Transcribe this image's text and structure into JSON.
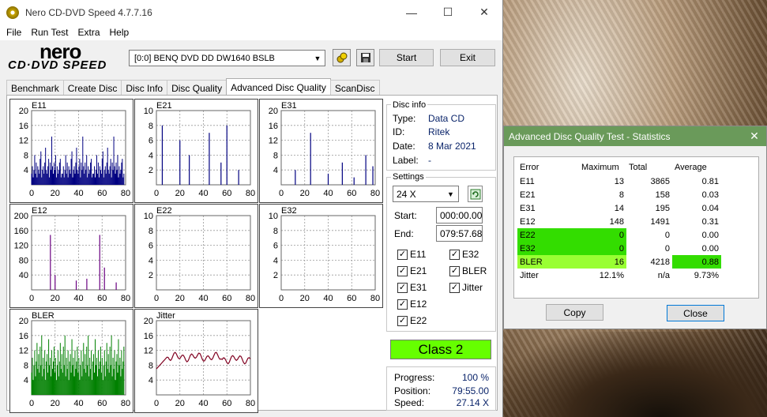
{
  "window": {
    "title": "Nero CD-DVD Speed 4.7.7.16"
  },
  "menu": [
    "File",
    "Run Test",
    "Extra",
    "Help"
  ],
  "logo": {
    "brand": "nero",
    "sub": "CD·DVD SPEED"
  },
  "drive": {
    "selected": "[0:0]   BENQ DVD DD DW1640 BSLB"
  },
  "buttons": {
    "start": "Start",
    "exit": "Exit"
  },
  "tabs": [
    "Benchmark",
    "Create Disc",
    "Disc Info",
    "Disc Quality",
    "Advanced Disc Quality",
    "ScanDisc"
  ],
  "charts": {
    "e11": {
      "label": "E11",
      "yticks": [
        "20",
        "16",
        "12",
        "8",
        "4"
      ],
      "xticks": [
        "0",
        "20",
        "40",
        "60",
        "80"
      ]
    },
    "e21": {
      "label": "E21",
      "yticks": [
        "10",
        "8",
        "6",
        "4",
        "2"
      ],
      "xticks": [
        "0",
        "20",
        "40",
        "60",
        "80"
      ]
    },
    "e31": {
      "label": "E31",
      "yticks": [
        "20",
        "16",
        "12",
        "8",
        "4"
      ],
      "xticks": [
        "0",
        "20",
        "40",
        "60",
        "80"
      ]
    },
    "e12": {
      "label": "E12",
      "yticks": [
        "200",
        "160",
        "120",
        "80",
        "40"
      ],
      "xticks": [
        "0",
        "20",
        "40",
        "60",
        "80"
      ]
    },
    "e22": {
      "label": "E22",
      "yticks": [
        "10",
        "8",
        "6",
        "4",
        "2"
      ],
      "xticks": [
        "0",
        "20",
        "40",
        "60",
        "80"
      ]
    },
    "e32": {
      "label": "E32",
      "yticks": [
        "10",
        "8",
        "6",
        "4",
        "2"
      ],
      "xticks": [
        "0",
        "20",
        "40",
        "60",
        "80"
      ]
    },
    "bler": {
      "label": "BLER",
      "yticks": [
        "20",
        "16",
        "12",
        "8",
        "4"
      ],
      "xticks": [
        "0",
        "20",
        "40",
        "60",
        "80"
      ]
    },
    "jitter": {
      "label": "Jitter",
      "yticks": [
        "20",
        "16",
        "12",
        "8",
        "4"
      ],
      "xticks": [
        "0",
        "20",
        "40",
        "60",
        "80"
      ]
    }
  },
  "disc_info": {
    "title": "Disc info",
    "type_label": "Type:",
    "type": "Data CD",
    "id_label": "ID:",
    "id": "Ritek",
    "date_label": "Date:",
    "date": "8 Mar 2021",
    "label_label": "Label:",
    "label": "-"
  },
  "settings": {
    "title": "Settings",
    "speed": "24 X",
    "start_label": "Start:",
    "start": "000:00.00",
    "end_label": "End:",
    "end": "079:57.68",
    "checks": {
      "e11": "E11",
      "e21": "E21",
      "e31": "E31",
      "e12": "E12",
      "e22": "E22",
      "e32": "E32",
      "bler": "BLER",
      "jitter": "Jitter"
    }
  },
  "class_label": "Class 2",
  "progress": {
    "progress_label": "Progress:",
    "progress": "100 %",
    "position_label": "Position:",
    "position": "79:55.00",
    "speed_label": "Speed:",
    "speed": "27.14 X"
  },
  "dialog": {
    "title": "Advanced Disc Quality Test - Statistics",
    "headers": [
      "Error",
      "Maximum",
      "Total",
      "Average"
    ],
    "rows": [
      [
        "E11",
        "13",
        "3865",
        "0.81"
      ],
      [
        "E21",
        "8",
        "158",
        "0.03"
      ],
      [
        "E31",
        "14",
        "195",
        "0.04"
      ],
      [
        "E12",
        "148",
        "1491",
        "0.31"
      ],
      [
        "E22",
        "0",
        "0",
        "0.00"
      ],
      [
        "E32",
        "0",
        "0",
        "0.00"
      ],
      [
        "BLER",
        "16",
        "4218",
        "0.88"
      ],
      [
        "Jitter",
        "12.1%",
        "n/a",
        "9.73%"
      ]
    ],
    "copy": "Copy",
    "close": "Close",
    "highlight_color": "#33dd00"
  }
}
